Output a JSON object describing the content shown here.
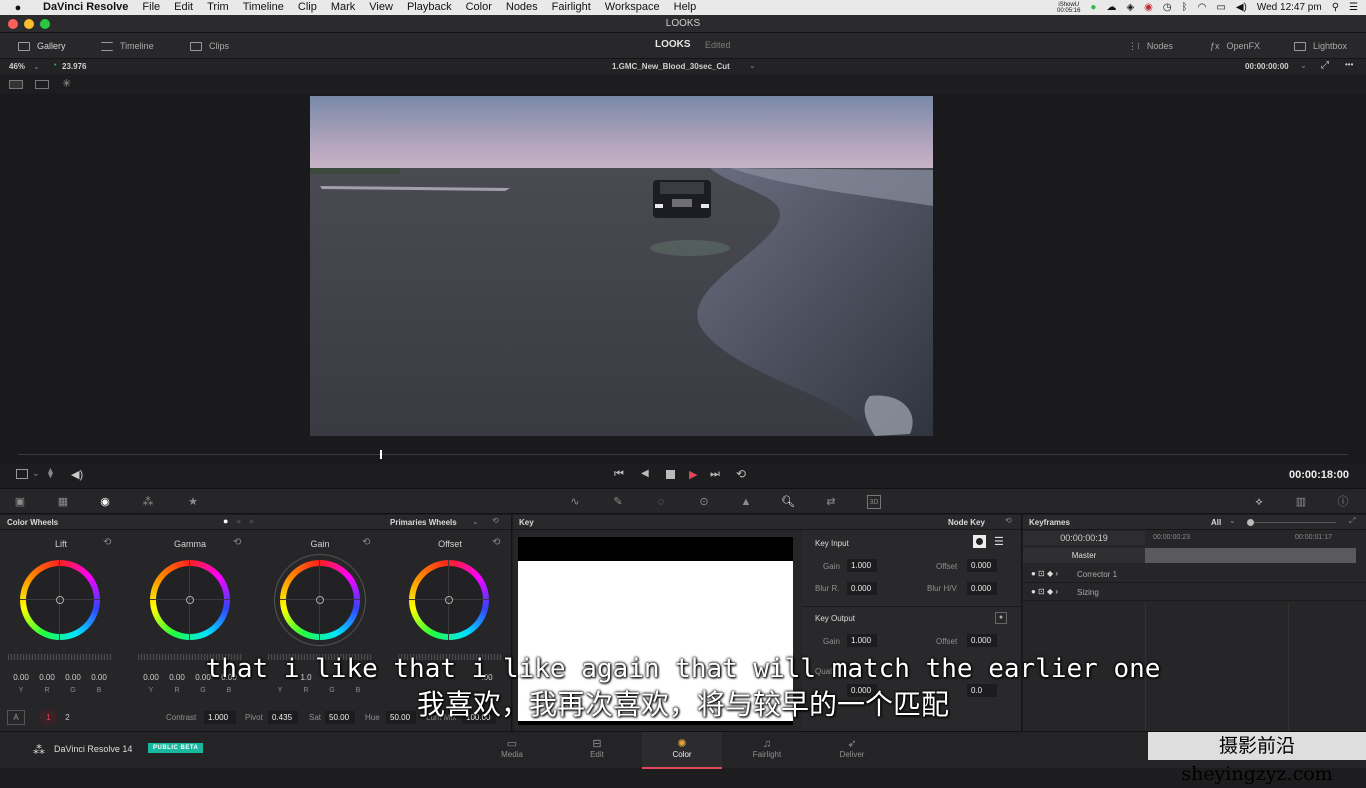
{
  "menubar": {
    "app_name": "DaVinci Resolve",
    "items": [
      "File",
      "Edit",
      "Trim",
      "Timeline",
      "Clip",
      "Mark",
      "View",
      "Playback",
      "Color",
      "Nodes",
      "Fairlight",
      "Workspace",
      "Help"
    ],
    "showu_top": "iShowU",
    "showu_time": "00:05:16",
    "clock": "Wed 12:47 pm"
  },
  "window": {
    "title": "LOOKS"
  },
  "toolbar": {
    "gallery": "Gallery",
    "timeline": "Timeline",
    "clips": "Clips",
    "project": "LOOKS",
    "status": "Edited",
    "nodes": "Nodes",
    "openfx": "OpenFX",
    "lightbox": "Lightbox"
  },
  "viewer": {
    "zoom": "46%",
    "fps": "23.976",
    "clip_name": "1.GMC_New_Blood_30sec_Cut",
    "timecode": "00:00:00:00"
  },
  "transport": {
    "timecode": "00:00:18:00"
  },
  "color_wheels": {
    "title": "Color Wheels",
    "mode": "Primaries Wheels",
    "wheels": [
      {
        "name": "Lift",
        "values": [
          "0.00",
          "0.00",
          "0.00",
          "0.00"
        ]
      },
      {
        "name": "Gamma",
        "values": [
          "0.00",
          "0.00",
          "0.00",
          "0.00"
        ]
      },
      {
        "name": "Gain",
        "values": [
          "1.0",
          "",
          "",
          ""
        ]
      },
      {
        "name": "Offset",
        "values": [
          "",
          "",
          "",
          ""
        ]
      }
    ],
    "channels": [
      "Y",
      "R",
      "G",
      "B"
    ],
    "a_label": "A",
    "page1": "1",
    "page2": "2",
    "contrast_label": "Contrast",
    "contrast": "1.000",
    "pivot_label": "Pivot",
    "pivot": "0.435",
    "sat_label": "Sat",
    "sat": "50.00",
    "hue_label": "Hue",
    "hue": "50.00",
    "lummix_label": "Lum Mix",
    "lummix": "100.00"
  },
  "key": {
    "title": "Key",
    "mode": "Node Key",
    "input_label": "Key Input",
    "gain_label": "Gain",
    "gain": "1.000",
    "offset_label": "Offset",
    "offset": "0.000",
    "blur_r_label": "Blur R.",
    "blur_r": "0.000",
    "blur_hv_label": "Blur H/V",
    "blur_hv": "0.000",
    "output_label": "Key Output",
    "out_gain": "1.000",
    "out_offset": "0.000",
    "qual_label": "Qual",
    "qual_val": "0.000",
    "qual_val2": "0.0"
  },
  "keyframes": {
    "title": "Keyframes",
    "filter": "All",
    "tc_current": "00:00:00:19",
    "tc_a": "00:00:00:23",
    "tc_b": "00:00:01:17",
    "master": "Master",
    "tracks": [
      "Corrector 1",
      "Sizing"
    ]
  },
  "bottom": {
    "app": "DaVinci Resolve 14",
    "badge": "PUBLIC BETA",
    "pages": [
      "Media",
      "Edit",
      "Color",
      "Fairlight",
      "Deliver"
    ],
    "active_page": "Color"
  },
  "subtitles": {
    "en": "that i like that i like again that will match the earlier one",
    "zh": "我喜欢，我再次喜欢，将与较早的一个匹配"
  },
  "watermark": "摄影前沿 sheyingzyz.com",
  "colors": {
    "accent": "#e0475a",
    "badge": "#19b8a0",
    "playhead": "#ffffff"
  }
}
